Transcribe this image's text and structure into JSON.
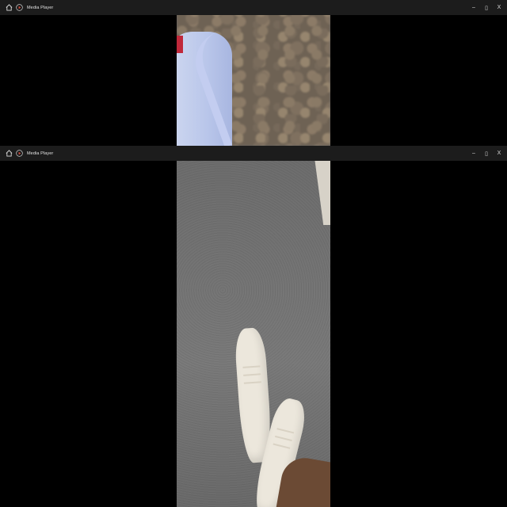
{
  "windows": [
    {
      "title": "Media Player",
      "controls": {
        "minimize": "–",
        "maximize": "▯",
        "close": "X"
      }
    },
    {
      "title": "Media Player",
      "controls": {
        "minimize": "–",
        "maximize": "▯",
        "close": "X"
      }
    }
  ],
  "icons": {
    "home": "home-icon",
    "app": "media-player-icon"
  },
  "colors": {
    "titlebar_bg": "#1c1c1c",
    "background": "#000000",
    "app_icon_accent": "#d94a3a"
  }
}
